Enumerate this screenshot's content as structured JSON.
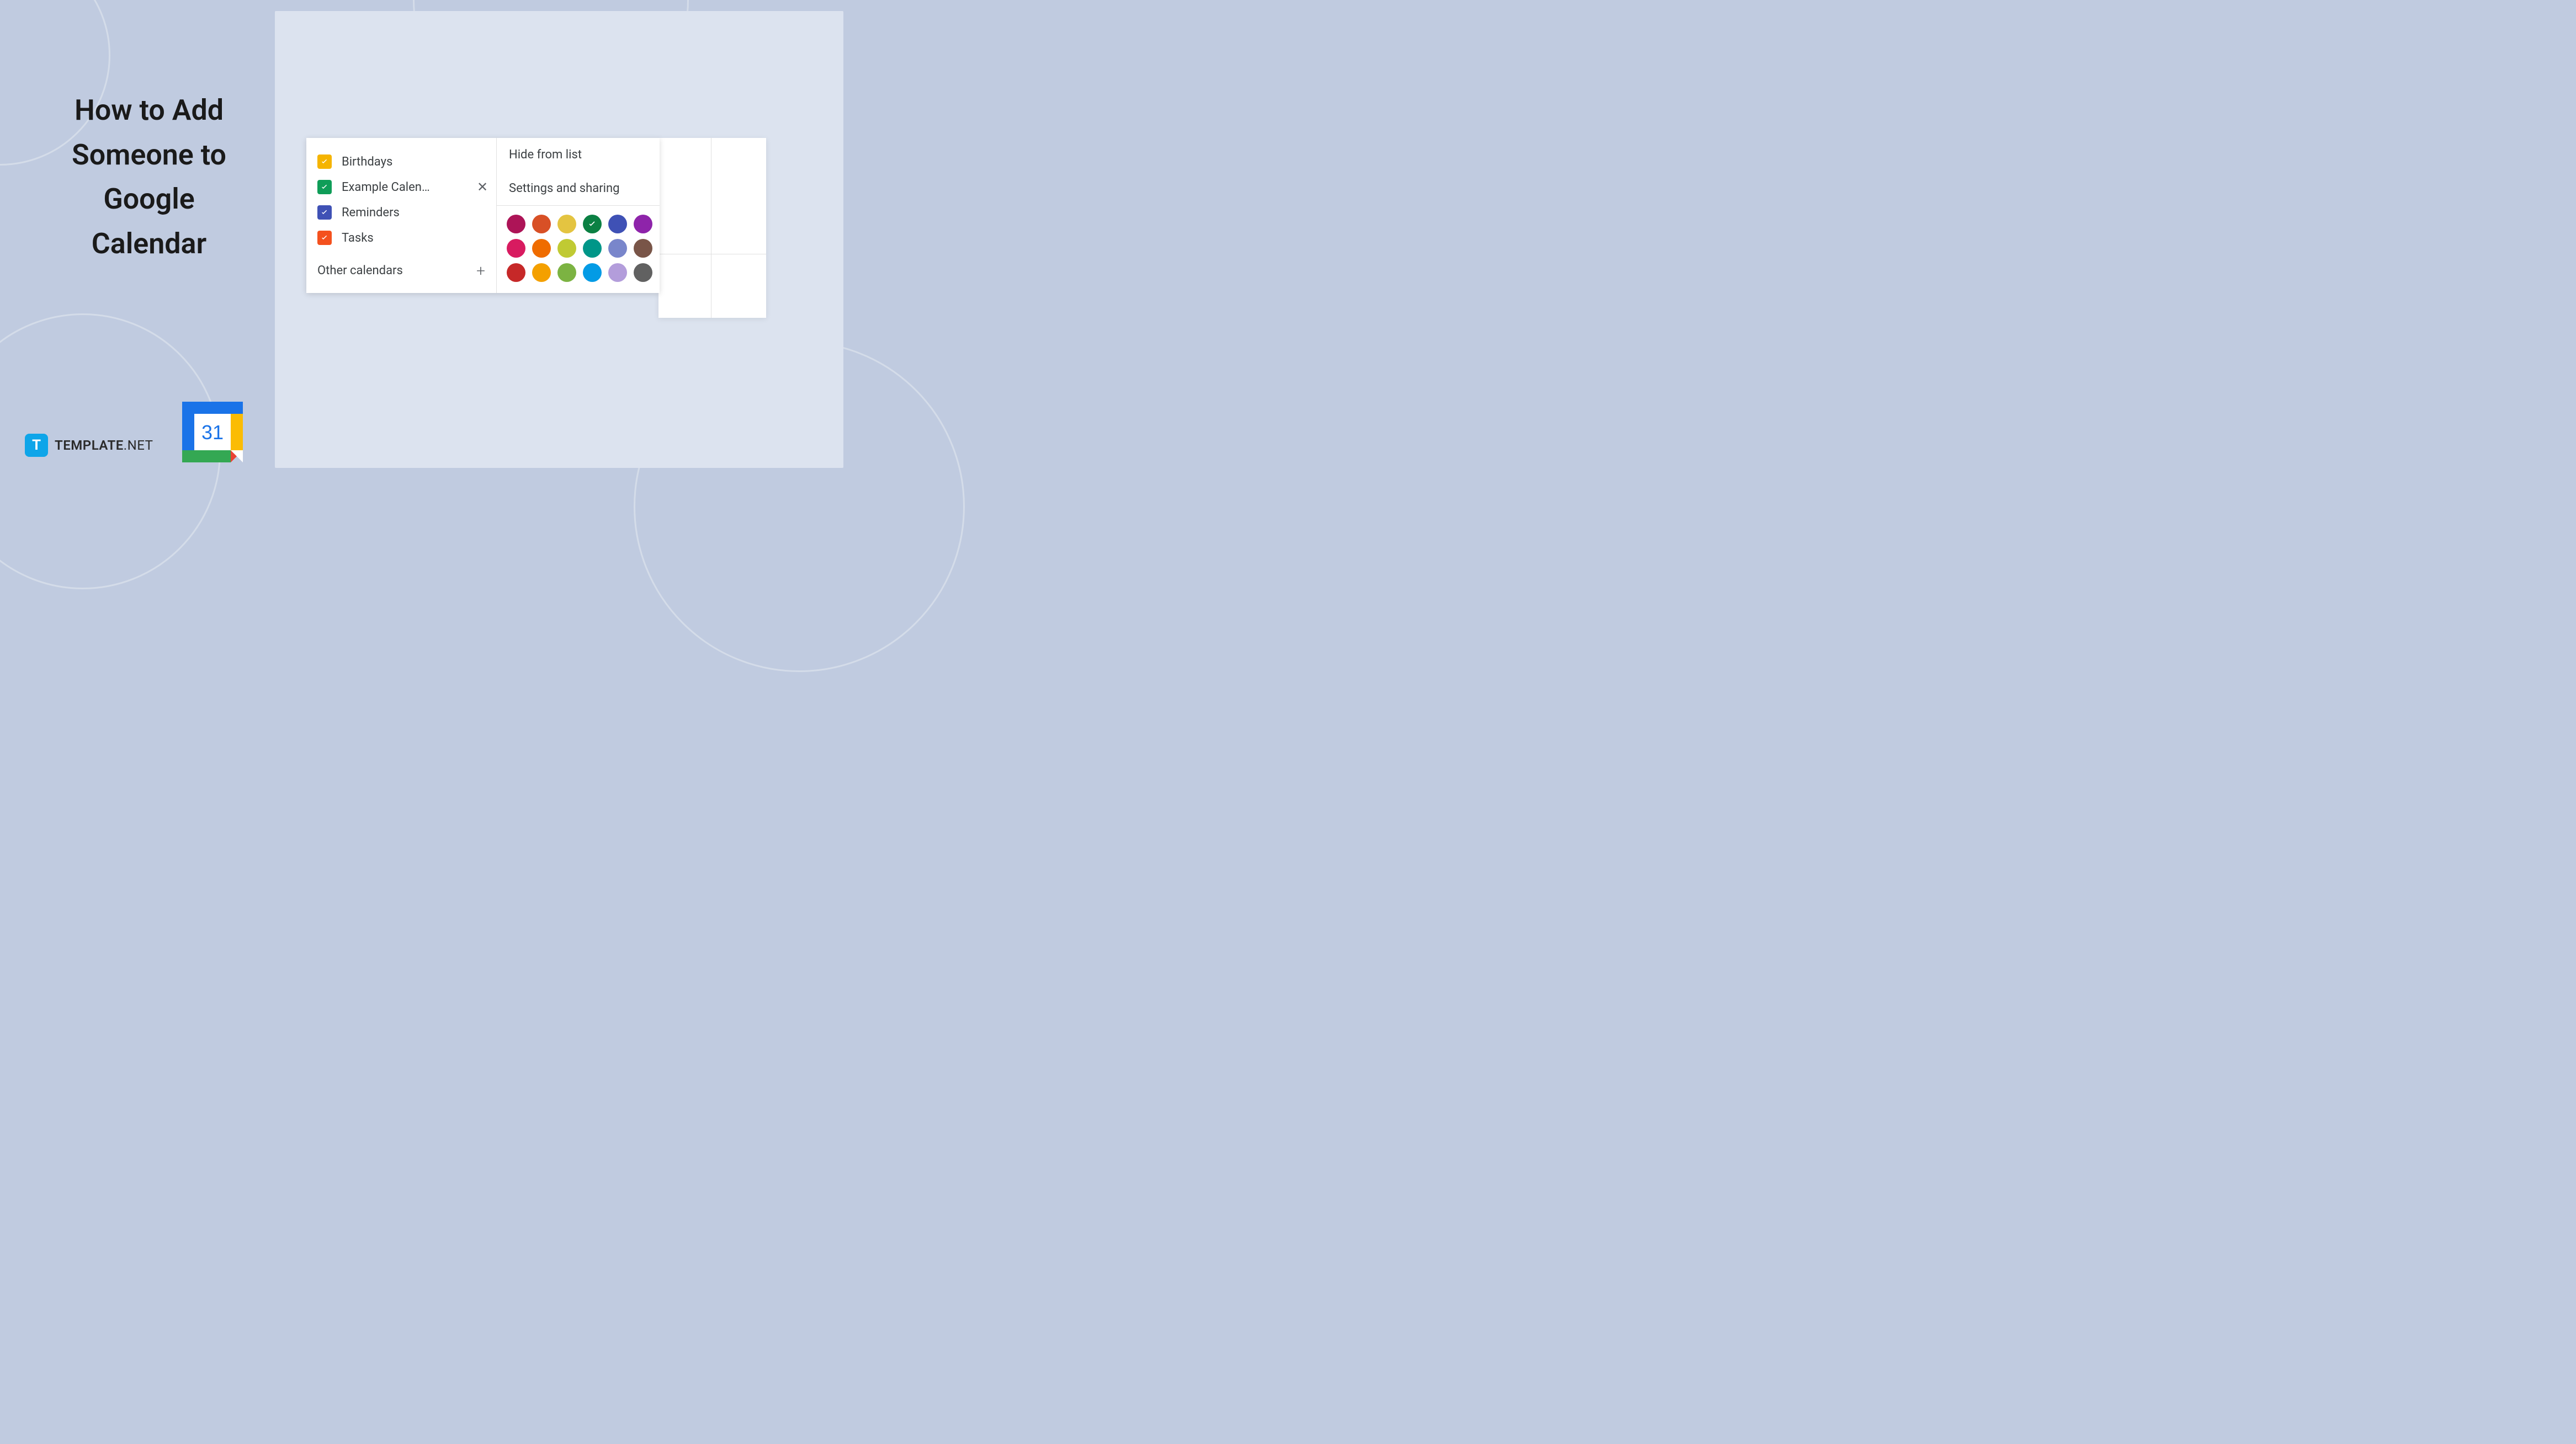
{
  "title": "How to Add Someone to Google Calendar",
  "calendars": [
    {
      "label": "Birthdays",
      "color": "#f5b400",
      "checked": true,
      "active": false
    },
    {
      "label": "Example Calen…",
      "color": "#0f9d58",
      "checked": true,
      "active": true
    },
    {
      "label": "Reminders",
      "color": "#3f51b5",
      "checked": true,
      "active": false
    },
    {
      "label": "Tasks",
      "color": "#f4511e",
      "checked": true,
      "active": false
    }
  ],
  "other_calendars_label": "Other calendars",
  "menu": {
    "hide": "Hide from list",
    "settings": "Settings and sharing"
  },
  "colors": [
    "#ad1457",
    "#d85026",
    "#e4c441",
    "#0b8043",
    "#3f51b5",
    "#8e24aa",
    "#d81b60",
    "#ef6c00",
    "#c0ca33",
    "#009688",
    "#7986cb",
    "#795548",
    "#c62828",
    "#f4a000",
    "#7cb342",
    "#039be5",
    "#b39ddb",
    "#616161"
  ],
  "selected_color_index": 3,
  "gcal_day": "31",
  "brand": {
    "icon_letter": "T",
    "name": "TEMPLATE",
    "suffix": ".NET"
  }
}
